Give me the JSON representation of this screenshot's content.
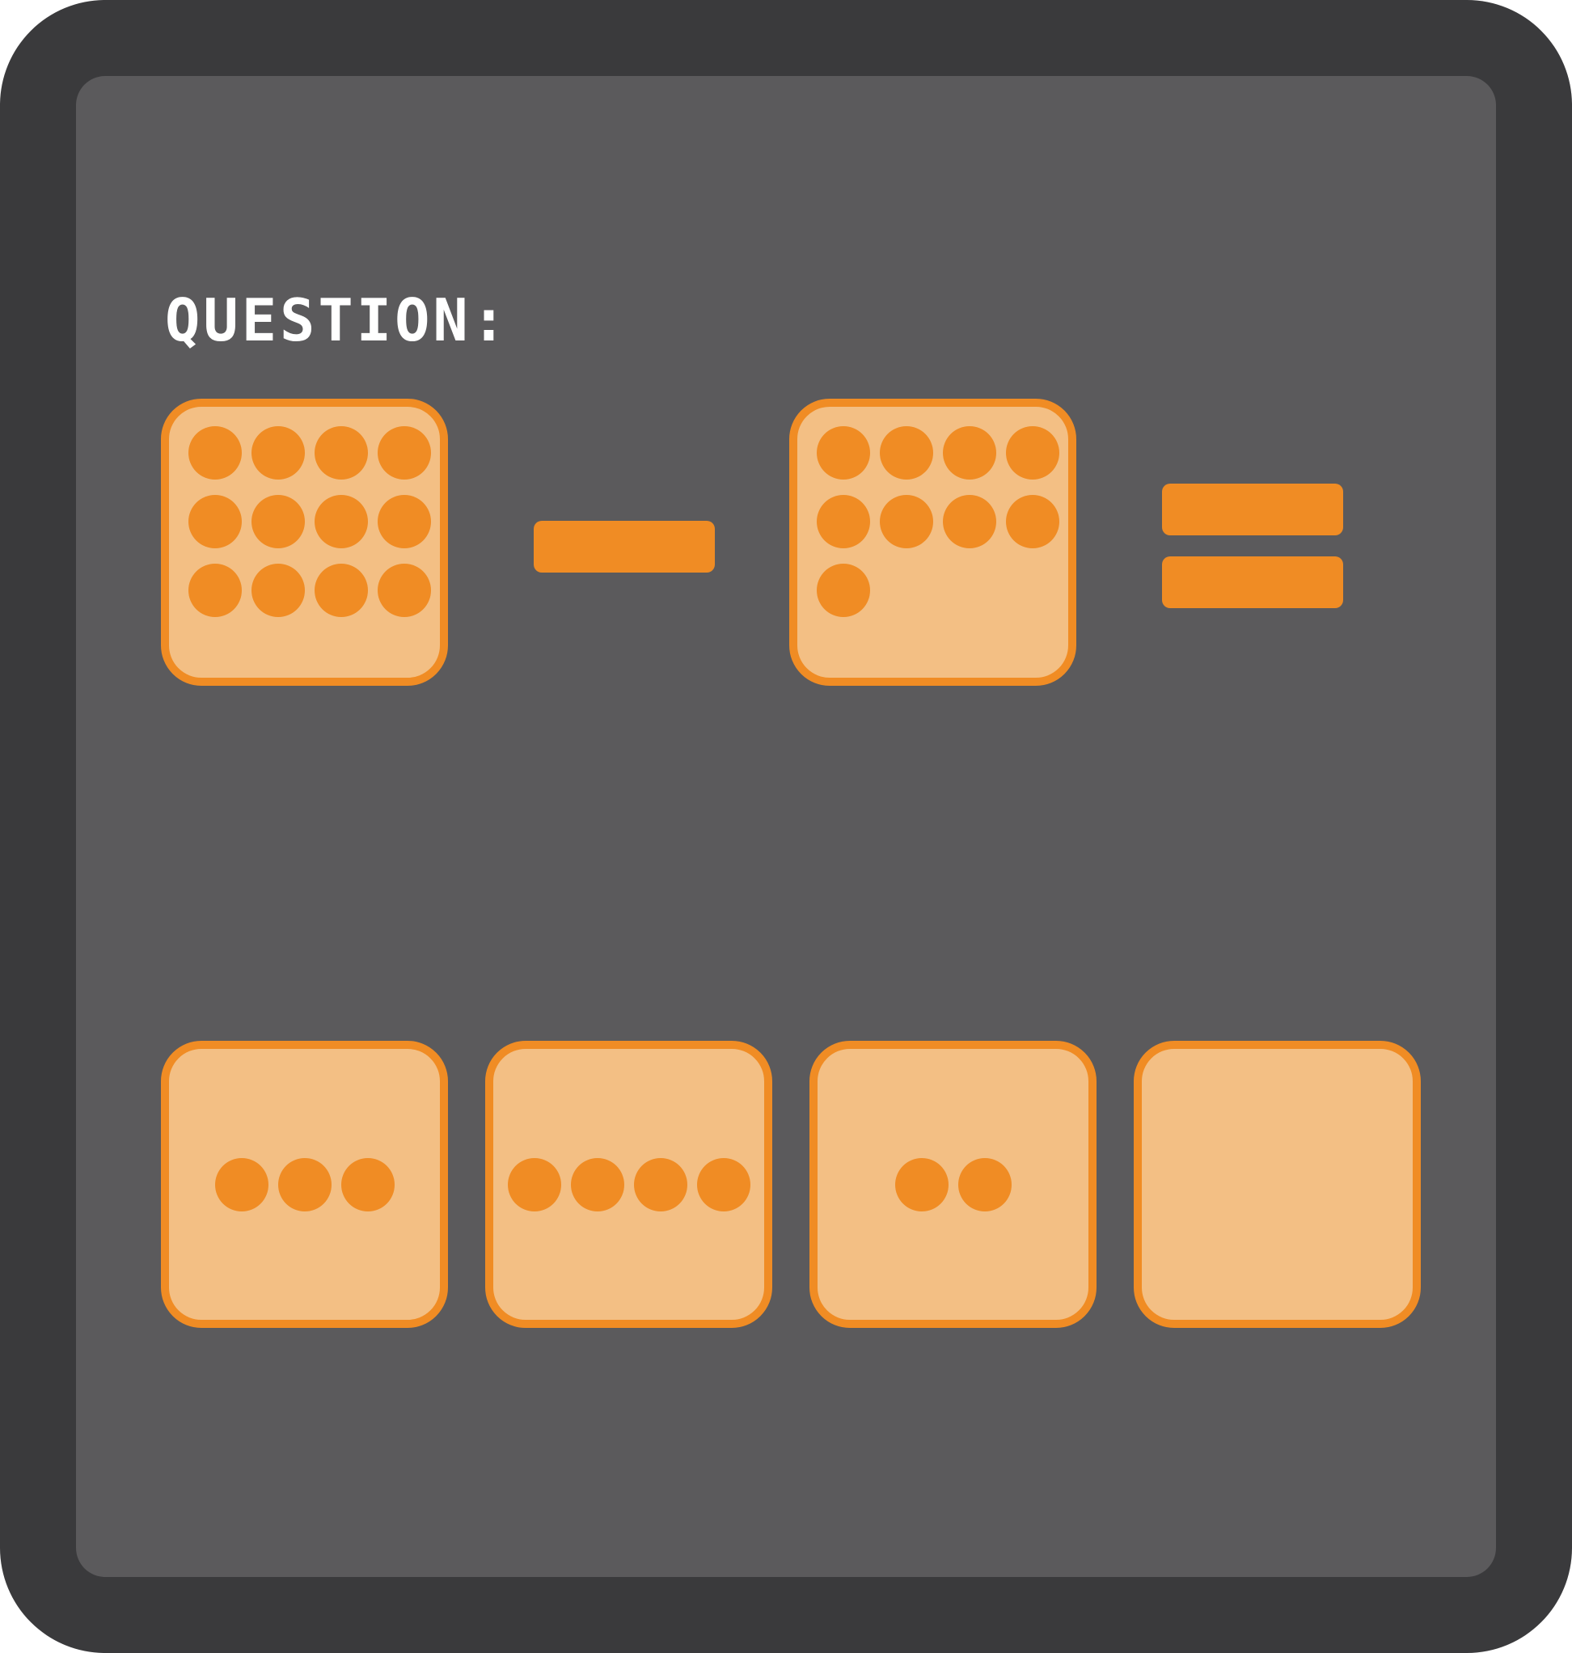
{
  "question": {
    "title": "QUESTION:",
    "minuend_dots": 12,
    "operator": "minus",
    "subtrahend_dots": 9,
    "equals": "equals"
  },
  "options": [
    {
      "dots": 3
    },
    {
      "dots": 4
    },
    {
      "dots": 2
    },
    {
      "dots": 0
    }
  ],
  "colors": {
    "frame": "#3a3a3c",
    "board": "#5b5a5c",
    "card_fill": "#f3bf84",
    "accent": "#f08c24",
    "title_text": "#ffffff"
  }
}
